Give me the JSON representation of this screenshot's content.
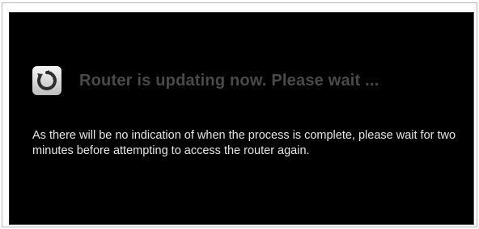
{
  "dialog": {
    "title": "Router is updating now. Please wait ...",
    "message": "As there will be no indication of when the process is complete, please wait for two minutes before attempting to access the router again.",
    "icon": "refresh-update-icon"
  },
  "colors": {
    "panel_background": "#000000",
    "title_text": "#4a4a4a",
    "message_text": "#e6e6e6",
    "icon_background": "#d8d8d8",
    "icon_glyph": "#2e2e2e"
  }
}
